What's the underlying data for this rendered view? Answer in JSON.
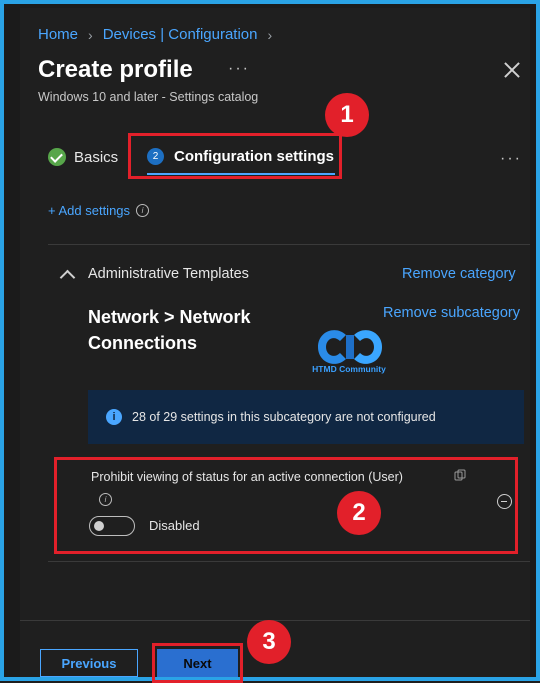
{
  "breadcrumb": {
    "items": [
      "Home",
      "Devices | Configuration"
    ]
  },
  "header": {
    "title": "Create profile",
    "more": "···",
    "subtitle": "Windows 10 and later - Settings catalog"
  },
  "steps": [
    {
      "label": "Basics",
      "state": "complete"
    },
    {
      "label": "Configuration settings",
      "number": "2",
      "state": "active"
    }
  ],
  "step_more": "···",
  "add_settings": {
    "label": "+ Add settings"
  },
  "category": {
    "label": "Administrative Templates",
    "remove_category": "Remove category",
    "remove_subcategory": "Remove subcategory",
    "subcategory_title": "Network > Network Connections"
  },
  "logo": {
    "text": "HTMD Community"
  },
  "info_banner": {
    "text": "28 of 29 settings in this subcategory are not configured"
  },
  "setting": {
    "label": "Prohibit viewing of status for an active connection (User)",
    "toggle_state_label": "Disabled",
    "enabled": false
  },
  "footer": {
    "previous": "Previous",
    "next": "Next"
  },
  "annotations": [
    "1",
    "2",
    "3"
  ],
  "colors": {
    "accent": "#4aa6ff",
    "highlight_red": "#e2202a",
    "background": "#1f1f1f",
    "primary_button": "#2a6fd0",
    "success": "#57a64a"
  }
}
